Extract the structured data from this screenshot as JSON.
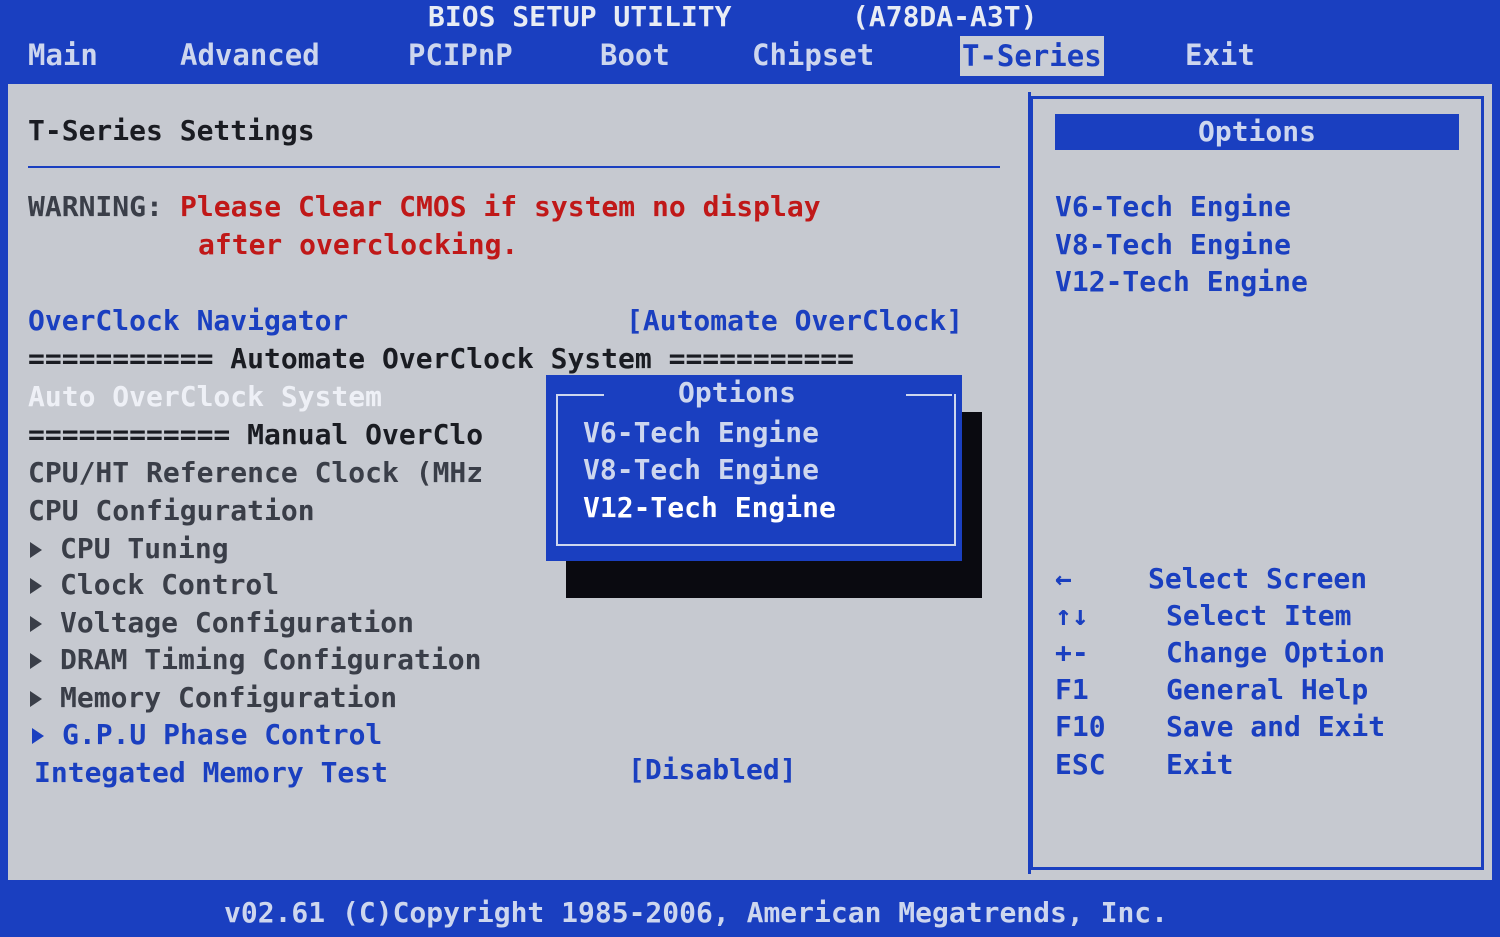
{
  "title_bar": {
    "title": "BIOS SETUP UTILITY",
    "board": "(A78DA-A3T)"
  },
  "menu": [
    "Main",
    "Advanced",
    "PCIPnP",
    "Boot",
    "Chipset",
    "T-Series",
    "Exit"
  ],
  "active_menu": "T-Series",
  "main": {
    "section_title": "T-Series Settings",
    "warning_label": "WARNING:",
    "warning_line1": "Please Clear CMOS if system no display",
    "warning_line2": "after overclocking.",
    "overclock_navigator": {
      "label": "OverClock Navigator",
      "value": "[Automate OverClock]"
    },
    "automate_sep": "=========== Automate OverClock System ===========",
    "auto_overclock_label": "Auto OverClock System",
    "manual_sep": "============ Manual OverClo",
    "cpu_ref_clock": "CPU/HT Reference Clock (MHz",
    "cpu_config": "CPU Configuration",
    "submenus": [
      "CPU Tuning",
      "Clock Control",
      "Voltage Configuration",
      "DRAM Timing Configuration",
      "Memory Configuration"
    ],
    "gpu_phase": "G.P.U Phase Control",
    "memory_test": {
      "label": "Integated Memory Test",
      "value": "[Disabled]"
    }
  },
  "popup": {
    "title": "Options",
    "options": [
      "V6-Tech Engine",
      "V8-Tech Engine",
      "V12-Tech Engine"
    ],
    "selected": "V12-Tech Engine"
  },
  "help": {
    "header": "Options",
    "options": [
      "V6-Tech Engine",
      "V8-Tech Engine",
      "V12-Tech Engine"
    ],
    "keys": [
      {
        "key": "←",
        "desc": "Select Screen"
      },
      {
        "key": "↑↓",
        "desc": "Select Item"
      },
      {
        "key": "+-",
        "desc": "Change Option"
      },
      {
        "key": "F1",
        "desc": "General Help"
      },
      {
        "key": "F10",
        "desc": "Save and Exit"
      },
      {
        "key": "ESC",
        "desc": "Exit"
      }
    ]
  },
  "footer": "v02.61 (C)Copyright 1985-2006, American Megatrends, Inc."
}
